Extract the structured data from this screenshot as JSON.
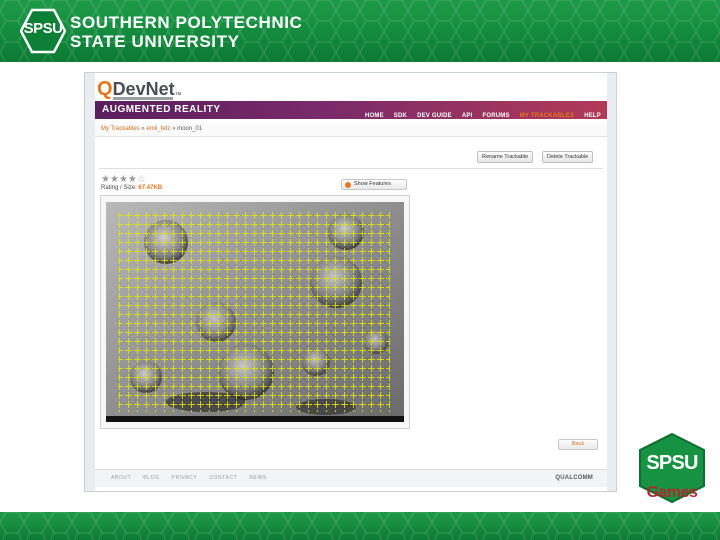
{
  "header": {
    "badge_text": "SPSU",
    "university_line1": "SOUTHERN POLYTECHNIC",
    "university_line2": "STATE UNIVERSITY",
    "brand_green": "#138a3d"
  },
  "screenshot": {
    "logo_q": "Q",
    "logo_devnet": "DevNet",
    "logo_tm": "™",
    "section_title": "AUGMENTED REALITY",
    "nav": [
      {
        "label": "HOME"
      },
      {
        "label": "SDK"
      },
      {
        "label": "DEV GUIDE"
      },
      {
        "label": "API"
      },
      {
        "label": "FORUMS"
      },
      {
        "label": "MY TRACKABLES"
      },
      {
        "label": "HELP"
      }
    ],
    "breadcrumb": {
      "root": "My Trackables",
      "sep": "»",
      "middle": "emil_fetz",
      "leaf": "moon_01"
    },
    "buttons": {
      "rename": "Rename Trackable",
      "delete": "Delete Trackable",
      "features": "Show Features",
      "back": "Back"
    },
    "rating": {
      "stars_filled": 4,
      "stars_total": 5,
      "label": "Rating / Size:",
      "value": "67.47KB"
    },
    "footer_links": [
      {
        "label": "ABOUT"
      },
      {
        "label": "BLOG"
      },
      {
        "label": "PRIVACY"
      },
      {
        "label": "CONTACT"
      },
      {
        "label": "NEWS"
      }
    ],
    "qualcomm": "QUALCOMM",
    "accent_orange": "#e8761f",
    "accent_purple": "#5a1f5c"
  },
  "games_badge": {
    "spsu": "SPSU",
    "games": "Games"
  }
}
